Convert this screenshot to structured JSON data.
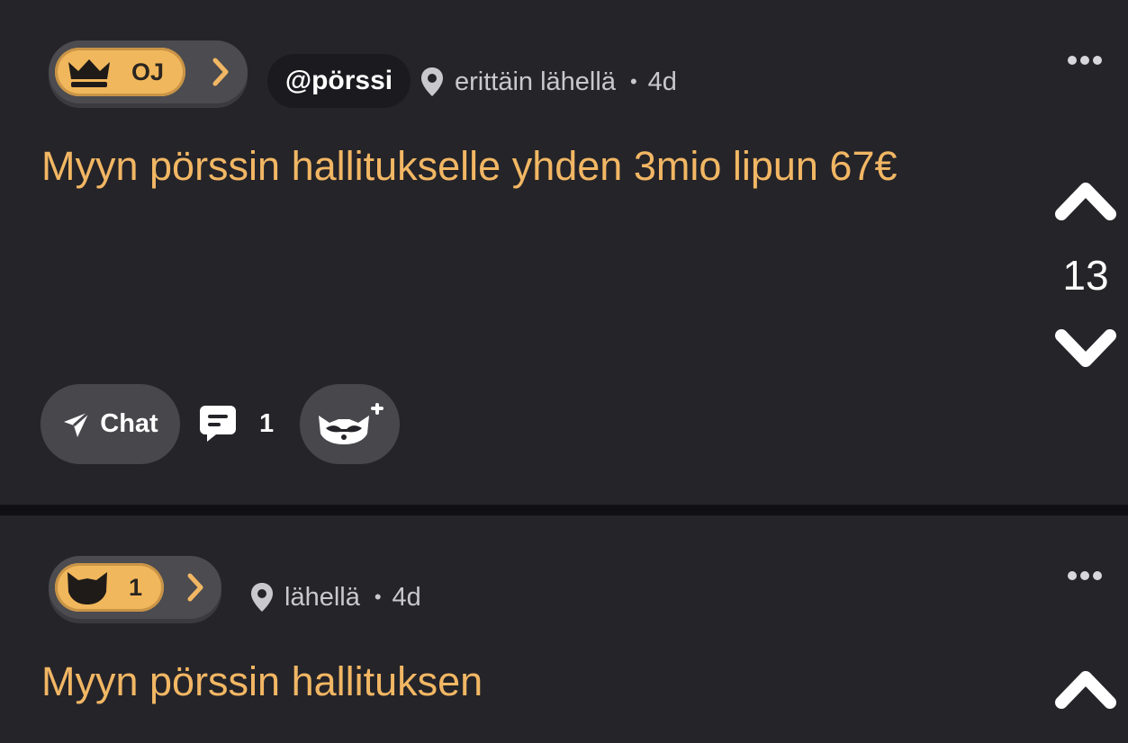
{
  "posts": [
    {
      "badge_text": "OJ",
      "badge_icon": "crown-icon",
      "handle": "@pörssi",
      "location": "erittäin lähellä",
      "age": "4d",
      "text": "Myyn pörssin hallitukselle yhden 3mio lipun 67€",
      "votes": "13",
      "chat_label": "Chat",
      "comment_count": "1"
    },
    {
      "badge_text": "1",
      "badge_icon": "cat-head-icon",
      "location": "lähellä",
      "age": "4d",
      "text": "Myyn pörssin hallituksen"
    }
  ],
  "colors": {
    "accent": "#f2b764",
    "background": "#252429",
    "separator": "#101014"
  }
}
